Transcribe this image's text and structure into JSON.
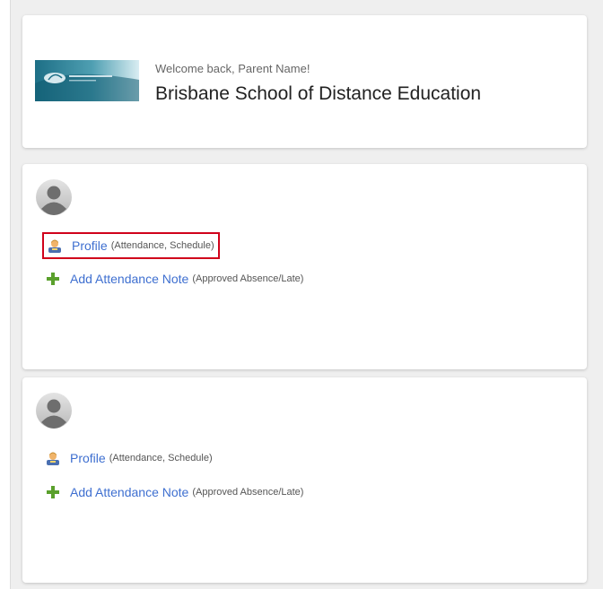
{
  "header": {
    "welcome": "Welcome back, Parent Name!",
    "school_name": "Brisbane School of Distance Education",
    "logo_icon": "school-logo"
  },
  "students": [
    {
      "avatar_icon": "user-silhouette",
      "profile": {
        "label": "Profile",
        "note": "(Attendance, Schedule)",
        "icon": "person-icon",
        "highlighted": true
      },
      "attendance_note": {
        "label": "Add Attendance Note",
        "note": "(Approved Absence/Late)",
        "icon": "plus-icon"
      }
    },
    {
      "avatar_icon": "user-silhouette",
      "profile": {
        "label": "Profile",
        "note": "(Attendance, Schedule)",
        "icon": "person-icon",
        "highlighted": false
      },
      "attendance_note": {
        "label": "Add Attendance Note",
        "note": "(Approved Absence/Late)",
        "icon": "plus-icon"
      }
    }
  ],
  "colors": {
    "link": "#3e6fd0",
    "highlight_border": "#d0021b",
    "plus_icon": "#5aa02c",
    "background": "#efefef"
  }
}
